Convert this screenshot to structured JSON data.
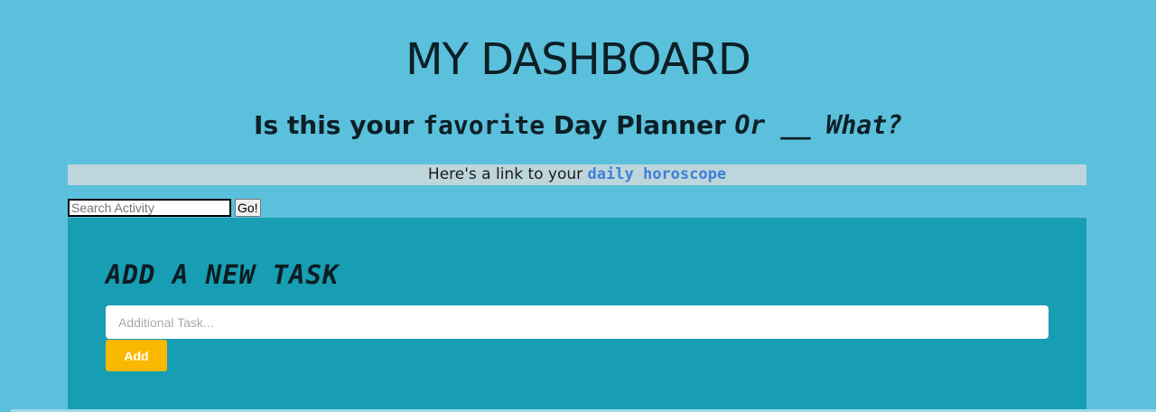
{
  "header": {
    "title": "MY DASHBOARD",
    "subtitle": {
      "part1": "Is this your ",
      "favorite": "favorite",
      "part2": " Day Planner ",
      "italic_tail": "Or __ What?"
    }
  },
  "banner": {
    "prefix": "Here's a link to your ",
    "link_text": "daily horoscope"
  },
  "search": {
    "placeholder": "Search Activity",
    "value": "",
    "go_label": "Go!"
  },
  "task_panel": {
    "heading": "ADD A NEW TASK",
    "input_placeholder": "Additional Task...",
    "input_value": "",
    "add_label": "Add"
  },
  "colors": {
    "page_bg": "#5bc0dc",
    "panel_bg": "#189eb3",
    "banner_bg": "#bdd6dc",
    "link": "#3f7fd8",
    "add_button": "#fbb800"
  }
}
